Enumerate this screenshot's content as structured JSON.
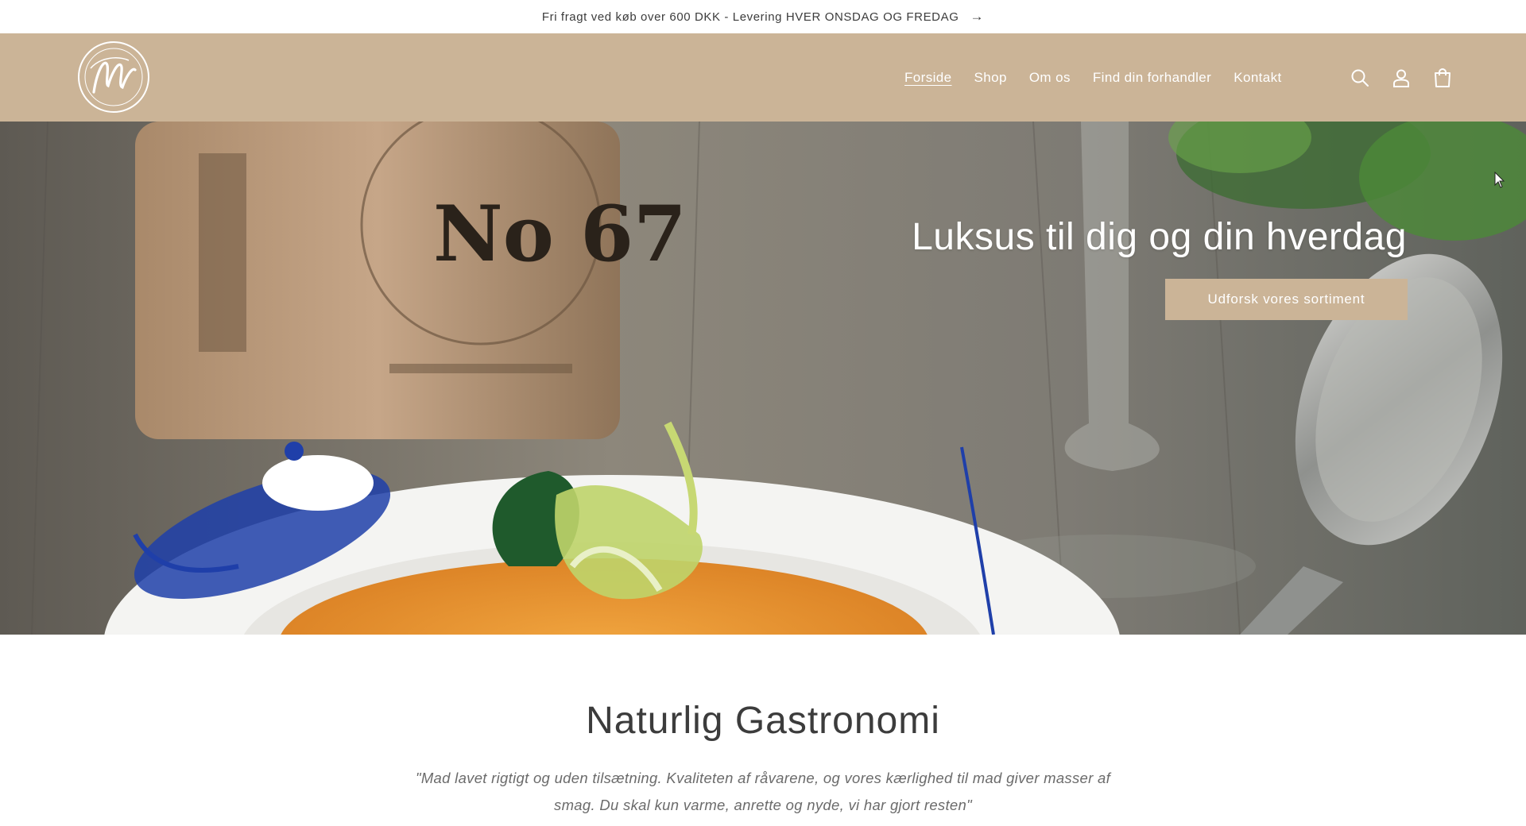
{
  "announcement": {
    "text": "Fri fragt ved køb over 600 DKK - Levering HVER ONSDAG OG FREDAG",
    "arrow": "→"
  },
  "header": {
    "logo_alt": "By Matteson logo",
    "nav": [
      "Forside",
      "Shop",
      "Om os",
      "Find din forhandler",
      "Kontakt"
    ],
    "active_nav": "Forside",
    "icons": [
      "search-icon",
      "account-icon",
      "cart-icon"
    ],
    "background": "#cbb497"
  },
  "hero": {
    "title": "Luksus til dig og din hverdag",
    "button_label": "Udforsk vores sortiment",
    "jar_label": "No 67"
  },
  "intro": {
    "title": "Naturlig Gastronomi",
    "quote": "\"Mad lavet rigtigt og uden tilsætning. Kvaliteten af råvarene, og vores kærlighed til mad giver masser af smag. Du skal kun varme, anrette og nyde, vi har gjort resten\""
  },
  "colors": {
    "accent": "#cbb497",
    "text": "#3c3c3c"
  }
}
